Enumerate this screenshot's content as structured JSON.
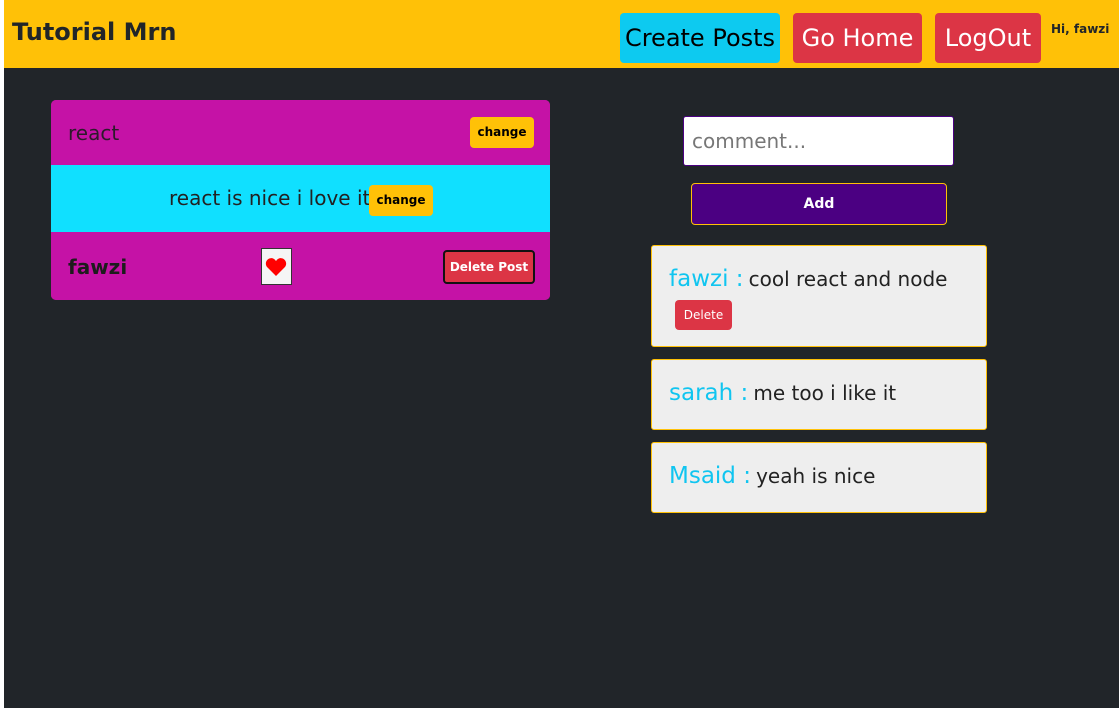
{
  "navbar": {
    "brand": "Tutorial Mrn",
    "create_posts_label": "Create Posts",
    "go_home_label": "Go Home",
    "logout_label": "LogOut",
    "greeting": "Hi, fawzi"
  },
  "post": {
    "title": "react",
    "body": "react is nice i love it",
    "change_label": "change",
    "author": "fawzi",
    "like_icon": "heart-icon",
    "delete_label": "Delete Post"
  },
  "comment_form": {
    "placeholder": "comment...",
    "add_label": "Add"
  },
  "comments": [
    {
      "author": "fawzi :",
      "text": "cool react and node",
      "delete_label": "Delete"
    },
    {
      "author": "sarah :",
      "text": "me too i like it"
    },
    {
      "author": "Msaid :",
      "text": "yeah is nice"
    }
  ],
  "colors": {
    "navbar": "#ffc107",
    "page_background": "#212529",
    "post_primary": "#c512a6",
    "post_body": "#10e0ff",
    "accent_button": "#4b0082",
    "danger": "#dc3545",
    "info": "#0dcaf0"
  }
}
